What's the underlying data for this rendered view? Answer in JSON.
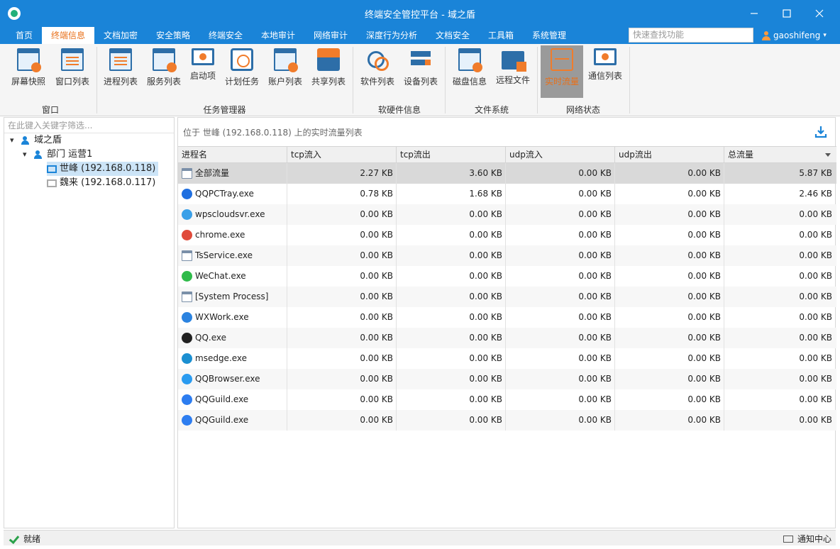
{
  "window": {
    "title": "终端安全管控平台 - 域之盾"
  },
  "menu": {
    "items": [
      "首页",
      "终端信息",
      "文档加密",
      "安全策略",
      "终端安全",
      "本地审计",
      "网络审计",
      "深度行为分析",
      "文档安全",
      "工具箱",
      "系统管理"
    ],
    "active_index": 1,
    "search_placeholder": "快速查找功能",
    "user": "gaoshifeng"
  },
  "ribbon": {
    "buttons": [
      "屏幕快照",
      "窗口列表",
      "进程列表",
      "服务列表",
      "启动项",
      "计划任务",
      "账户列表",
      "共享列表",
      "软件列表",
      "设备列表",
      "磁盘信息",
      "远程文件",
      "实时流量",
      "通信列表"
    ],
    "selected_index": 12,
    "groups": [
      "窗口",
      "任务管理器",
      "软硬件信息",
      "文件系统",
      "网络状态"
    ]
  },
  "tree": {
    "filter_placeholder": "在此键入关键字筛选...",
    "root": "域之盾",
    "dept": "部门 运营1",
    "nodes": [
      "世峰 (192.168.0.118)",
      "魏来 (192.168.0.117)"
    ]
  },
  "main": {
    "location": "位于 世峰 (192.168.0.118) 上的实时流量列表",
    "columns": [
      "进程名",
      "tcp流入",
      "tcp流出",
      "udp流入",
      "udp流出",
      "总流量"
    ],
    "rows": [
      {
        "name": "全部流量",
        "icon": "window-icon",
        "tcp_in": "2.27 KB",
        "tcp_out": "3.60 KB",
        "udp_in": "0.00 KB",
        "udp_out": "0.00 KB",
        "total": "5.87 KB"
      },
      {
        "name": "QQPCTray.exe",
        "icon": "shield-icon",
        "tcp_in": "0.78 KB",
        "tcp_out": "1.68 KB",
        "udp_in": "0.00 KB",
        "udp_out": "0.00 KB",
        "total": "2.46 KB"
      },
      {
        "name": "wpscloudsvr.exe",
        "icon": "cloud-icon",
        "tcp_in": "0.00 KB",
        "tcp_out": "0.00 KB",
        "udp_in": "0.00 KB",
        "udp_out": "0.00 KB",
        "total": "0.00 KB"
      },
      {
        "name": "chrome.exe",
        "icon": "chrome-icon",
        "tcp_in": "0.00 KB",
        "tcp_out": "0.00 KB",
        "udp_in": "0.00 KB",
        "udp_out": "0.00 KB",
        "total": "0.00 KB"
      },
      {
        "name": "TsService.exe",
        "icon": "window-icon",
        "tcp_in": "0.00 KB",
        "tcp_out": "0.00 KB",
        "udp_in": "0.00 KB",
        "udp_out": "0.00 KB",
        "total": "0.00 KB"
      },
      {
        "name": "WeChat.exe",
        "icon": "wechat-icon",
        "tcp_in": "0.00 KB",
        "tcp_out": "0.00 KB",
        "udp_in": "0.00 KB",
        "udp_out": "0.00 KB",
        "total": "0.00 KB"
      },
      {
        "name": "[System Process]",
        "icon": "window-icon",
        "tcp_in": "0.00 KB",
        "tcp_out": "0.00 KB",
        "udp_in": "0.00 KB",
        "udp_out": "0.00 KB",
        "total": "0.00 KB"
      },
      {
        "name": "WXWork.exe",
        "icon": "wxwork-icon",
        "tcp_in": "0.00 KB",
        "tcp_out": "0.00 KB",
        "udp_in": "0.00 KB",
        "udp_out": "0.00 KB",
        "total": "0.00 KB"
      },
      {
        "name": "QQ.exe",
        "icon": "qq-icon",
        "tcp_in": "0.00 KB",
        "tcp_out": "0.00 KB",
        "udp_in": "0.00 KB",
        "udp_out": "0.00 KB",
        "total": "0.00 KB"
      },
      {
        "name": "msedge.exe",
        "icon": "edge-icon",
        "tcp_in": "0.00 KB",
        "tcp_out": "0.00 KB",
        "udp_in": "0.00 KB",
        "udp_out": "0.00 KB",
        "total": "0.00 KB"
      },
      {
        "name": "QQBrowser.exe",
        "icon": "qqbrowser-icon",
        "tcp_in": "0.00 KB",
        "tcp_out": "0.00 KB",
        "udp_in": "0.00 KB",
        "udp_out": "0.00 KB",
        "total": "0.00 KB"
      },
      {
        "name": "QQGuild.exe",
        "icon": "qqguild-icon",
        "tcp_in": "0.00 KB",
        "tcp_out": "0.00 KB",
        "udp_in": "0.00 KB",
        "udp_out": "0.00 KB",
        "total": "0.00 KB"
      },
      {
        "name": "QQGuild.exe",
        "icon": "qqguild-icon",
        "tcp_in": "0.00 KB",
        "tcp_out": "0.00 KB",
        "udp_in": "0.00 KB",
        "udp_out": "0.00 KB",
        "total": "0.00 KB"
      }
    ]
  },
  "status": {
    "text": "就绪",
    "notify": "通知中心"
  },
  "colors": {
    "titlebar": "#1a84d8",
    "accent": "#e8701a",
    "selected_row": "#d9d9d9"
  }
}
